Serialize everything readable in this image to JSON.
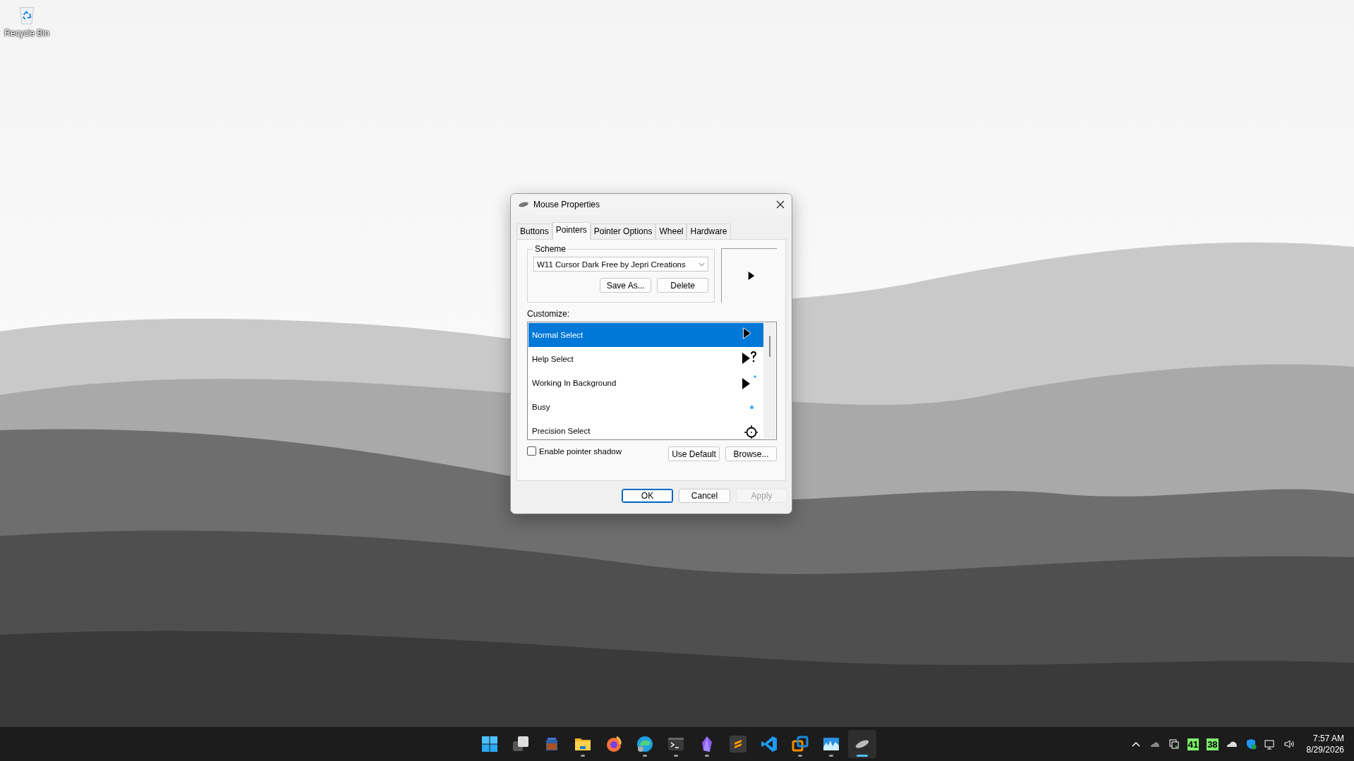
{
  "desktop": {
    "icons": [
      {
        "label": "Recycle Bin",
        "kind": "recycle"
      }
    ]
  },
  "dialog": {
    "title": "Mouse Properties",
    "tabs": [
      {
        "label": "Buttons",
        "selected": false
      },
      {
        "label": "Pointers",
        "selected": true
      },
      {
        "label": "Pointer Options",
        "selected": false
      },
      {
        "label": "Wheel",
        "selected": false
      },
      {
        "label": "Hardware",
        "selected": false
      }
    ],
    "scheme": {
      "label": "Scheme",
      "value": "W11 Cursor Dark Free by Jepri Creations",
      "buttons": [
        "Save As...",
        "Delete"
      ]
    },
    "customize": {
      "label": "Customize:",
      "items": [
        {
          "name": "Normal Select",
          "kind": "arrow",
          "selected": true
        },
        {
          "name": "Help Select",
          "kind": "help",
          "selected": false
        },
        {
          "name": "Working In Background",
          "kind": "working",
          "selected": false
        },
        {
          "name": "Busy",
          "kind": "busy",
          "selected": false
        },
        {
          "name": "Precision Select",
          "kind": "precision",
          "selected": false
        }
      ]
    },
    "shadow": {
      "label": "Enable pointer shadow",
      "checked": false
    },
    "list_buttons": [
      "Use Default",
      "Browse..."
    ],
    "buttons": [
      {
        "label": "OK",
        "default": true,
        "disabled": false
      },
      {
        "label": "Cancel",
        "default": false,
        "disabled": false
      },
      {
        "label": "Apply",
        "default": false,
        "disabled": true
      }
    ]
  },
  "taskbar": {
    "apps": [
      {
        "kind": "start",
        "running": false,
        "active": false
      },
      {
        "kind": "taskview",
        "running": false,
        "active": false
      },
      {
        "kind": "jar",
        "running": false,
        "active": false
      },
      {
        "kind": "folder",
        "running": true,
        "active": false
      },
      {
        "kind": "firefox",
        "running": false,
        "active": false
      },
      {
        "kind": "edge",
        "running": true,
        "active": false
      },
      {
        "kind": "terminal",
        "running": true,
        "active": false
      },
      {
        "kind": "crystal",
        "running": true,
        "active": false
      },
      {
        "kind": "sublime",
        "running": false,
        "active": false
      },
      {
        "kind": "vscode",
        "running": false,
        "active": false
      },
      {
        "kind": "vbox",
        "running": true,
        "active": false
      },
      {
        "kind": "monitor",
        "running": true,
        "active": false
      },
      {
        "kind": "mouse",
        "running": true,
        "active": true
      }
    ],
    "tray": {
      "badges": [
        "41",
        "38"
      ],
      "time": "7:57 AM",
      "date": "8/29/2026"
    }
  }
}
